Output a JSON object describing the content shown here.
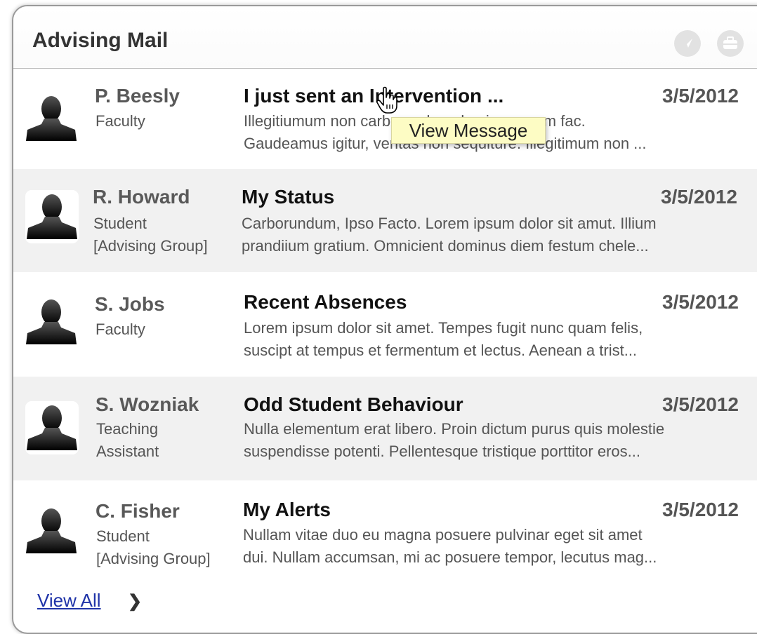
{
  "panel": {
    "title": "Advising Mail",
    "header_icons": [
      "compass-icon",
      "briefcase-icon"
    ]
  },
  "messages": [
    {
      "sender": "P. Beesly",
      "role_lines": [
        "Faculty"
      ],
      "subject": "I just sent an Intervention ...",
      "date": "3/5/2012",
      "preview_lines": [
        "Illegitiumum non carborundum domine savum fac.",
        "Gaudeamus igitur, veritas non sequiture. Illegitimum non ..."
      ]
    },
    {
      "sender": "R. Howard",
      "role_lines": [
        "Student",
        "[Advising Group]"
      ],
      "subject": "My Status",
      "date": "3/5/2012",
      "preview_lines": [
        "Carborundum, Ipso Facto. Lorem ipsum dolor sit amut. Illium",
        "prandiium gratium. Omnicient dominus diem festum chele..."
      ]
    },
    {
      "sender": "S. Jobs",
      "role_lines": [
        "Faculty"
      ],
      "subject": "Recent Absences",
      "date": "3/5/2012",
      "preview_lines": [
        "Lorem ipsum dolor sit amet. Tempes fugit nunc quam felis,",
        "suscipt at tempus et fermentum et lectus. Aenean a trist..."
      ]
    },
    {
      "sender": "S. Wozniak",
      "role_lines": [
        "Teaching",
        "Assistant"
      ],
      "subject": "Odd Student Behaviour",
      "date": "3/5/2012",
      "preview_lines": [
        "Nulla elementum erat libero. Proin dictum purus quis molestie",
        "suspendisse potenti. Pellentesque tristique porttitor eros..."
      ]
    },
    {
      "sender": "C. Fisher",
      "role_lines": [
        "Student",
        "[Advising Group]"
      ],
      "subject": "My Alerts",
      "date": "3/5/2012",
      "preview_lines": [
        "Nullam vitae duo eu magna posuere pulvinar eget sit amet",
        "dui. Nullam accumsan, mi ac posuere tempor, lecutus mag..."
      ]
    }
  ],
  "tooltip": {
    "text": "View Message"
  },
  "footer": {
    "view_all_label": "View All",
    "chevron_icon": "chevron-right-icon"
  },
  "colors": {
    "alt_row": "#f1f1f1",
    "link": "#1f33a8",
    "tooltip_bg": "#fdfcc4"
  }
}
